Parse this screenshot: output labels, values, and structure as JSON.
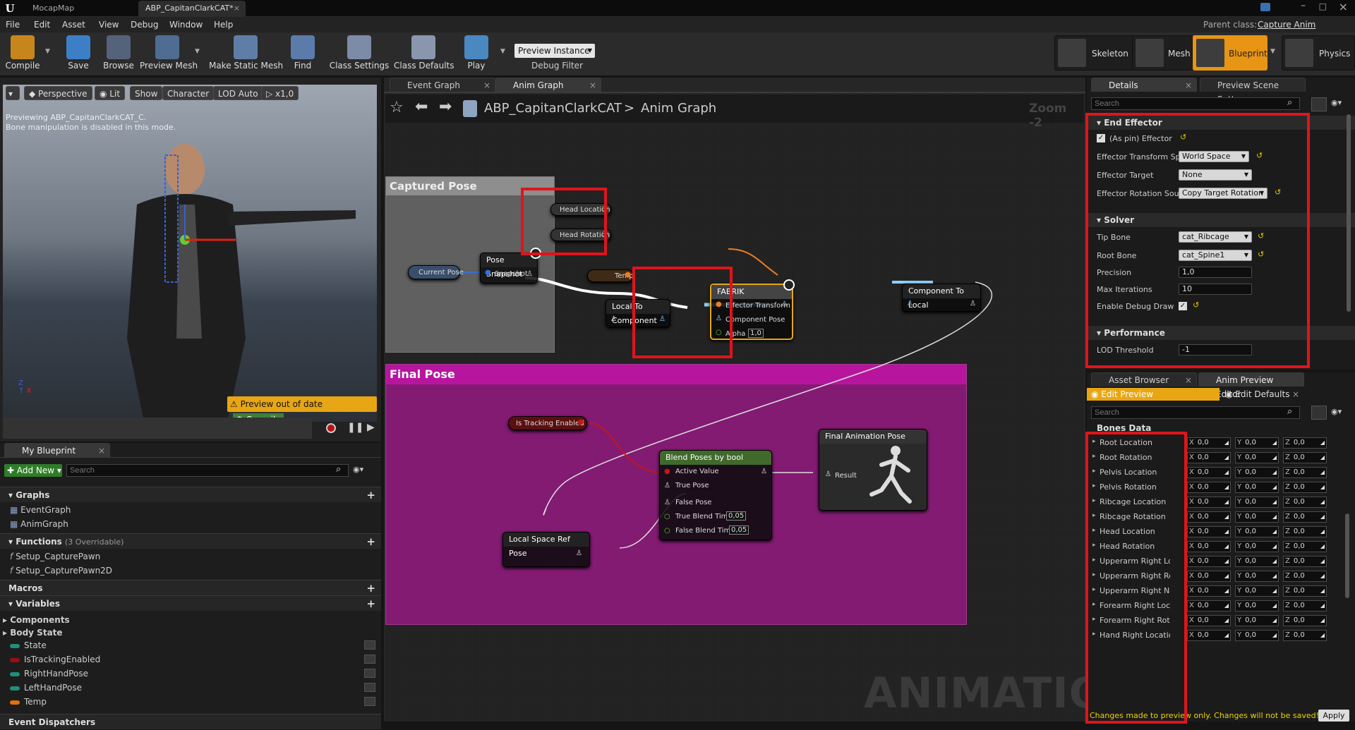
{
  "titlebar": {
    "tabs": [
      "MocapMap",
      "ABP_CapitanClarkCAT*"
    ]
  },
  "menu": {
    "items": [
      "File",
      "Edit",
      "Asset",
      "View",
      "Debug",
      "Window",
      "Help"
    ],
    "parent_label": "Parent class:",
    "parent_value": "Capture Anim Blueprint"
  },
  "toolbar": {
    "compile": "Compile",
    "save": "Save",
    "browse": "Browse",
    "preview_mesh": "Preview Mesh",
    "make_static_mesh": "Make Static Mesh",
    "find": "Find",
    "class_settings": "Class Settings",
    "class_defaults": "Class Defaults",
    "play": "Play",
    "preview_instance": "Preview Instance",
    "debug_filter": "Debug Filter"
  },
  "modes": [
    "Skeleton",
    "Mesh",
    "Blueprint",
    "Physics"
  ],
  "viewport": {
    "perspective": "Perspective",
    "lit": "Lit",
    "show": "Show",
    "character": "Character",
    "lod": "LOD Auto",
    "speed": "x1,0",
    "info1": "Previewing ABP_CapitanClarkCAT_C.",
    "info2": "Bone manipulation is disabled in this mode.",
    "out_of_date": "Preview out of date",
    "compile": "Compile"
  },
  "my_blueprint": {
    "tab": "My Blueprint",
    "add_new": "Add New",
    "search_placeholder": "Search",
    "graphs_label": "Graphs",
    "graphs": [
      "EventGraph",
      "AnimGraph"
    ],
    "functions_label": "Functions",
    "functions_note": "(3 Overridable)",
    "functions": [
      "Setup_CapturePawn",
      "Setup_CapturePawn2D"
    ],
    "macros_label": "Macros",
    "variables_label": "Variables",
    "components_label": "Components",
    "body_state_label": "Body State",
    "variables": [
      {
        "name": "State",
        "color": "#1f8f7a"
      },
      {
        "name": "IsTrackingEnabled",
        "color": "#9a1010"
      },
      {
        "name": "RightHandPose",
        "color": "#1f8f7a"
      },
      {
        "name": "LeftHandPose",
        "color": "#1f8f7a"
      },
      {
        "name": "Temp",
        "color": "#e07010"
      }
    ],
    "dispatchers_label": "Event Dispatchers"
  },
  "graph": {
    "tabs": [
      "Event Graph",
      "Anim Graph"
    ],
    "bc_asset": "ABP_CapitanClarkCAT",
    "bc_sep": ">",
    "bc_graph": "Anim Graph",
    "zoom": "Zoom -2",
    "watermark": "ANIMATION",
    "captured_pose": "Captured Pose",
    "final_pose": "Final Pose",
    "head_location": "Head Location",
    "head_rotation": "Head Rotation",
    "current_pose": "Current Pose",
    "pose_snapshot": "Pose Snapshot",
    "snapshot": "Snapshot",
    "temp": "Temp",
    "local_to_component": "Local To Component",
    "fabrik": "FABRIK",
    "effector_transform": "Effector Transform",
    "component_pose": "Component Pose",
    "alpha": "Alpha",
    "alpha_value": "1,0",
    "component_to_local": "Component To Local",
    "is_tracking_enabled": "Is Tracking Enabled",
    "blend_poses": "Blend Poses by bool",
    "active_value": "Active Value",
    "true_pose": "True Pose",
    "false_pose": "False Pose",
    "true_blend": "True Blend Time",
    "true_blend_value": "0,05",
    "false_blend": "False Blend Time",
    "false_blend_value": "0,05",
    "local_ref_pose": "Local Space Ref Pose",
    "final_anim_pose": "Final Animation Pose",
    "result": "Result"
  },
  "details": {
    "tabs": [
      "Details",
      "Preview Scene Sett"
    ],
    "search_placeholder": "Search",
    "end_effector": "End Effector",
    "as_pin_effector": "(As pin) Effector",
    "effector_transform_space": "Effector Transform Sp",
    "effector_transform_space_value": "World Space",
    "effector_target": "Effector Target",
    "effector_target_value": "None",
    "effector_rotation_source": "Effector Rotation Sour",
    "effector_rotation_source_value": "Copy Target Rotation",
    "solver": "Solver",
    "tip_bone": "Tip Bone",
    "tip_bone_value": "cat_Ribcage",
    "root_bone": "Root Bone",
    "root_bone_value": "cat_Spine1",
    "precision": "Precision",
    "precision_value": "1,0",
    "max_iterations": "Max Iterations",
    "max_iterations_value": "10",
    "enable_debug_draw": "Enable Debug Draw",
    "performance": "Performance",
    "lod_threshold": "LOD Threshold",
    "lod_threshold_value": "-1"
  },
  "preview_editor": {
    "tabs": [
      "Asset Browser",
      "Anim Preview Editor"
    ],
    "edit_preview": "Edit Preview",
    "edit_defaults": "Edit Defaults",
    "search_placeholder": "Search",
    "bones_header": "Bones Data",
    "bones": [
      "Root Location",
      "Root Rotation",
      "Pelvis Location",
      "Pelvis Rotation",
      "Ribcage Location",
      "Ribcage Rotation",
      "Head Location",
      "Head Rotation",
      "Upperarm Right Locatio",
      "Upperarm Right Rotatio",
      "Upperarm Right No Rol",
      "Forearm Right Location",
      "Forearm Right Rotation",
      "Hand Right Location"
    ],
    "axis_x": "X",
    "axis_y": "Y",
    "axis_z": "Z",
    "value": "0,0",
    "footer": "Changes made to preview only. Changes will not be saved!",
    "apply": "Apply"
  }
}
